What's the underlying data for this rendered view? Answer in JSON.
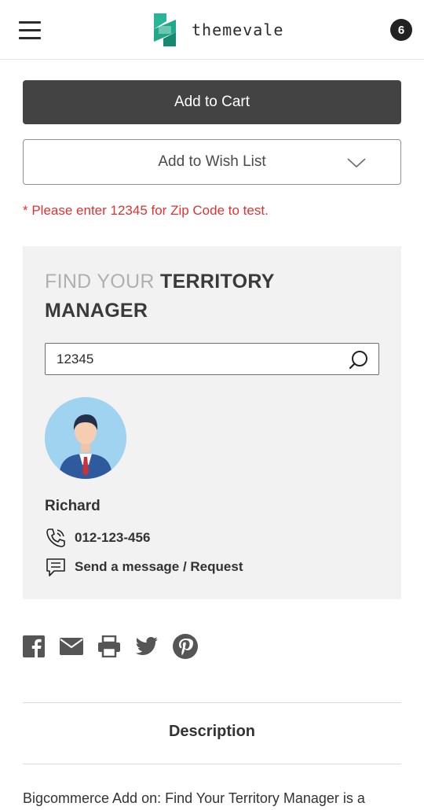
{
  "header": {
    "brand": "themevale",
    "cart_count": "6"
  },
  "product_actions": {
    "add_to_cart": "Add to Cart",
    "add_to_wish_list": "Add to Wish List"
  },
  "zip_note": "* Please enter 12345 for Zip Code to test.",
  "territory": {
    "title_light": "FIND YOUR",
    "title_bold": "TERRITORY MANAGER",
    "search_value": "12345",
    "manager": {
      "name": "Richard",
      "phone": "012-123-456",
      "message_label": "Send a message / Request"
    }
  },
  "social_icons": [
    "facebook-icon",
    "email-icon",
    "print-icon",
    "twitter-icon",
    "pinterest-icon"
  ],
  "tabs": {
    "description": "Description"
  },
  "description_text": "Bigcommerce Add on: Find Your Territory Manager is a",
  "colors": {
    "primary_button": "#434343",
    "error_text": "#e03232",
    "panel_bg": "#f2f2f2",
    "brand_green": "#1fa889"
  }
}
